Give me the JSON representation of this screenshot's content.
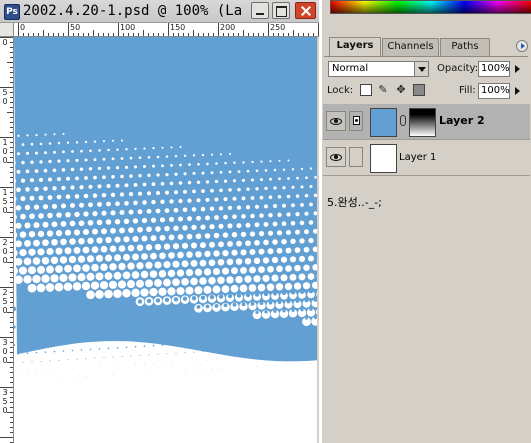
{
  "document_window": {
    "title": "2002.4.20-1.psd @ 100% (La...",
    "app_icon_glyph": "Ps",
    "minimize_icon": "minimize-icon",
    "maximize_icon": "maximize-icon",
    "close_icon": "close-icon"
  },
  "rulers": {
    "horizontal_labels": [
      "0",
      "50",
      "100",
      "150",
      "200",
      "250"
    ],
    "vertical_labels": [
      "0",
      "5 0",
      "1 0 0",
      "1 5 0",
      "2 0 0",
      "2 5 0",
      "3 0 0",
      "3 5 0"
    ]
  },
  "canvas": {
    "top_color": "#629fd3",
    "dot_color": "#ffffff",
    "bottom_color": "#ffffff"
  },
  "layers_panel": {
    "tabs": [
      {
        "label": "Layers",
        "active": true
      },
      {
        "label": "Channels",
        "active": false
      },
      {
        "label": "Paths",
        "active": false
      }
    ],
    "blend_mode": "Normal",
    "opacity_label": "Opacity:",
    "opacity_value": "100%",
    "lock_label": "Lock:",
    "fill_label": "Fill:",
    "fill_value": "100%",
    "layers": [
      {
        "name": "Layer 2",
        "selected": true,
        "visible": true,
        "has_mask": true,
        "thumb_color": "#629fd3"
      },
      {
        "name": "Layer 1",
        "selected": false,
        "visible": true,
        "has_mask": false,
        "thumb_color": "#ffffff"
      }
    ],
    "note": "5.완성..-_-;"
  }
}
